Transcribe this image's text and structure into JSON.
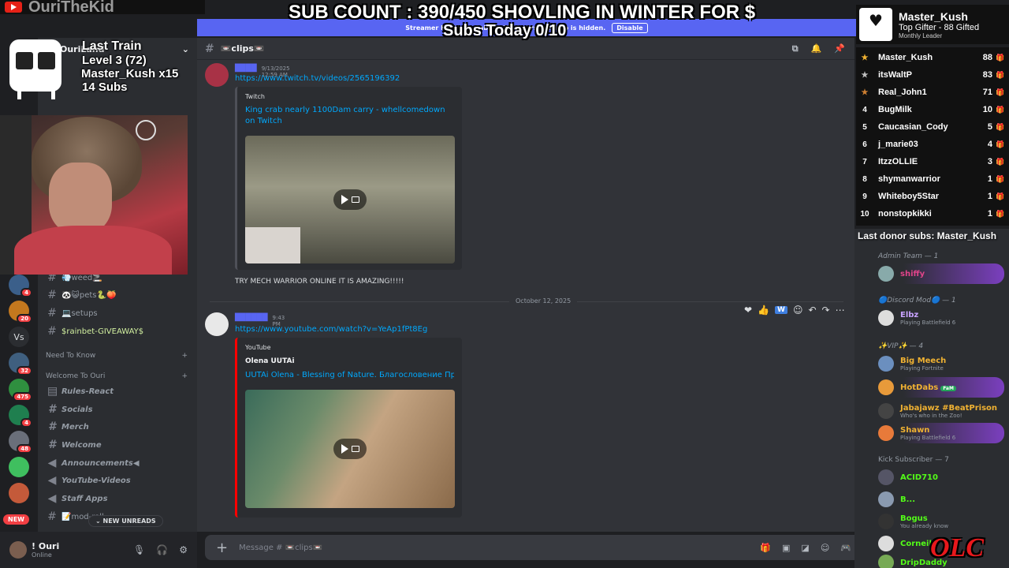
{
  "stream": {
    "channel_name": "OuriTheKid",
    "sub_count": "SUB COUNT : 390/450 SHOVLING IN WINTER FOR $",
    "subs_today": "Subs Today  0/10",
    "train": {
      "title": "Last Train",
      "level": "Level 3  (72)",
      "leader": "Master_Kush x15",
      "subs": "14 Subs"
    },
    "top_gifter": {
      "name": "Master_Kush",
      "title": "Top Gifter - 88 Gifted",
      "subtitle": "Monthly Leader"
    },
    "leaderboard": [
      {
        "rank": "★",
        "name": "Master_Kush",
        "value": "88"
      },
      {
        "rank": "★",
        "name": "itsWaltP",
        "value": "83"
      },
      {
        "rank": "★",
        "name": "Real_John1",
        "value": "71"
      },
      {
        "rank": "4",
        "name": "BugMilk",
        "value": "10"
      },
      {
        "rank": "5",
        "name": "Caucasian_Cody",
        "value": "5"
      },
      {
        "rank": "6",
        "name": "j_marie03",
        "value": "4"
      },
      {
        "rank": "7",
        "name": "ItzzOLLIE",
        "value": "3"
      },
      {
        "rank": "8",
        "name": "shymanwarrior",
        "value": "1"
      },
      {
        "rank": "9",
        "name": "Whiteboy5Star",
        "value": "1"
      },
      {
        "rank": "10",
        "name": "nonstopkikki",
        "value": "1"
      }
    ],
    "last_donor": "Last donor subs: Master_Kush",
    "logo": "OLC"
  },
  "banner": {
    "text": "Streamer Mode is enabled. Your personal info is hidden.",
    "button": "Disable"
  },
  "sidebar": {
    "server_name": "OuriLand",
    "channels": [
      {
        "icon": "#",
        "label": "💨weed🚬"
      },
      {
        "icon": "#",
        "label": "🐼😺pets🐍🍑"
      },
      {
        "icon": "#",
        "label": "💻setups"
      },
      {
        "icon": "#",
        "label": "$rainbet-GIVEAWAY$"
      }
    ],
    "category1": "Need To Know",
    "category2": "Welcome To Ouri",
    "welcome_channels": [
      {
        "icon": "▤",
        "label": "Rules-React"
      },
      {
        "icon": "#",
        "label": "Socials"
      },
      {
        "icon": "#",
        "label": "Merch"
      },
      {
        "icon": "#",
        "label": "Welcome"
      },
      {
        "icon": "◀",
        "label": "Announcements◀"
      },
      {
        "icon": "◀",
        "label": "YouTube-Videos"
      },
      {
        "icon": "◀",
        "label": "Staff Apps"
      },
      {
        "icon": "#",
        "label": "📝mod-roll"
      }
    ],
    "new_unreads": "NEW UNREADS",
    "badges": [
      "4",
      "20",
      "32",
      "475",
      "4",
      "48"
    ],
    "new_badge": "NEW"
  },
  "user": {
    "name": "! Ouri",
    "status": "Online"
  },
  "channel": {
    "name": "📼clips📼"
  },
  "messages": [
    {
      "time": "9/13/2025 12:59 AM",
      "link": "https://www.twitch.tv/videos/2565196392",
      "provider": "Twitch",
      "title": "King crab nearly 1100Dam carry - whellcomedown on Twitch",
      "text": "TRY MECH WARRIOR ONLINE IT IS AMAZING!!!!!"
    },
    {
      "time": "9:43 PM",
      "link": "https://www.youtube.com/watch?v=YeAp1fPt8Eg",
      "provider": "YouTube",
      "author": "Olena UUTAi",
      "title": "UUTAi Olena - Blessing of Nature. Благословение При..."
    }
  ],
  "date_divider": "October 12, 2025",
  "composer_placeholder": "Message # 📼clips📼",
  "members": {
    "groups": [
      {
        "label": "Admin Team — 1"
      },
      {
        "label": "🔵Discord Mod🔵 — 1"
      },
      {
        "label": "✨VIP✨ — 4"
      },
      {
        "label": "Kick Subscriber — 7"
      }
    ],
    "admin": [
      {
        "name": "shiffy",
        "status": ""
      }
    ],
    "mod": [
      {
        "name": "Elbz",
        "status": "Playing Battlefield 6"
      }
    ],
    "vip": [
      {
        "name": "Big Meech",
        "status": "Playing Fortnite"
      },
      {
        "name": "HotDabs",
        "status": "",
        "tag": "FaM"
      },
      {
        "name": "Jabajawz #BeatPrison",
        "status": "Who's who in the Zoo!"
      },
      {
        "name": "Shawn",
        "status": "Playing Battlefield 6"
      }
    ],
    "kick": [
      {
        "name": "ACID710",
        "status": ""
      },
      {
        "name": "B...",
        "status": ""
      },
      {
        "name": "Bogus",
        "status": "You already know"
      },
      {
        "name": "Corneil",
        "status": ""
      },
      {
        "name": "DripDaddy",
        "status": ""
      }
    ]
  },
  "colors": {
    "accent": "#5865f2",
    "link": "#00a8fc",
    "online": "#23a55a",
    "admin": "#e0448a",
    "mod": "#c9a2ff",
    "vip": "#f0b232",
    "kick": "#53fc18"
  }
}
